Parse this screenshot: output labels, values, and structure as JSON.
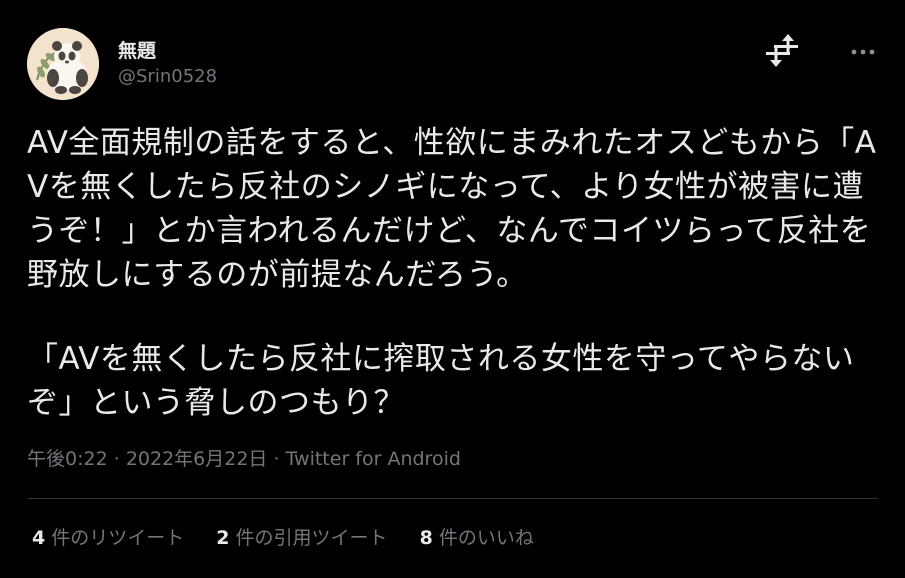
{
  "user": {
    "display_name": "無題",
    "handle": "@Srin0528"
  },
  "tweet": {
    "paragraph_1": "AV全面規制の話をすると、性欲にまみれたオスどもから「AVを無くしたら反社のシノギになって、より女性が被害に遭うぞ！」とか言われるんだけど、なんでコイツらって反社を野放しにするのが前提なんだろう。",
    "paragraph_2": "「AVを無くしたら反社に搾取される女性を守ってやらないぞ」という脅しのつもり？"
  },
  "meta": {
    "time": "午後0:22",
    "separator_1": "·",
    "date": "2022年6月22日",
    "separator_2": "·",
    "source": "Twitter for Android"
  },
  "stats": {
    "retweets": {
      "count": "4",
      "label": "件のリツイート"
    },
    "quotes": {
      "count": "2",
      "label": "件の引用ツイート"
    },
    "likes": {
      "count": "8",
      "label": "件のいいね"
    }
  },
  "icons": {
    "avatar": "panda-avatar",
    "action": "retweet-icon",
    "menu": "more-icon"
  },
  "colors": {
    "background": "#000000",
    "text_primary": "#e7e9ea",
    "text_secondary": "#71767b",
    "divider": "#2f3336"
  }
}
